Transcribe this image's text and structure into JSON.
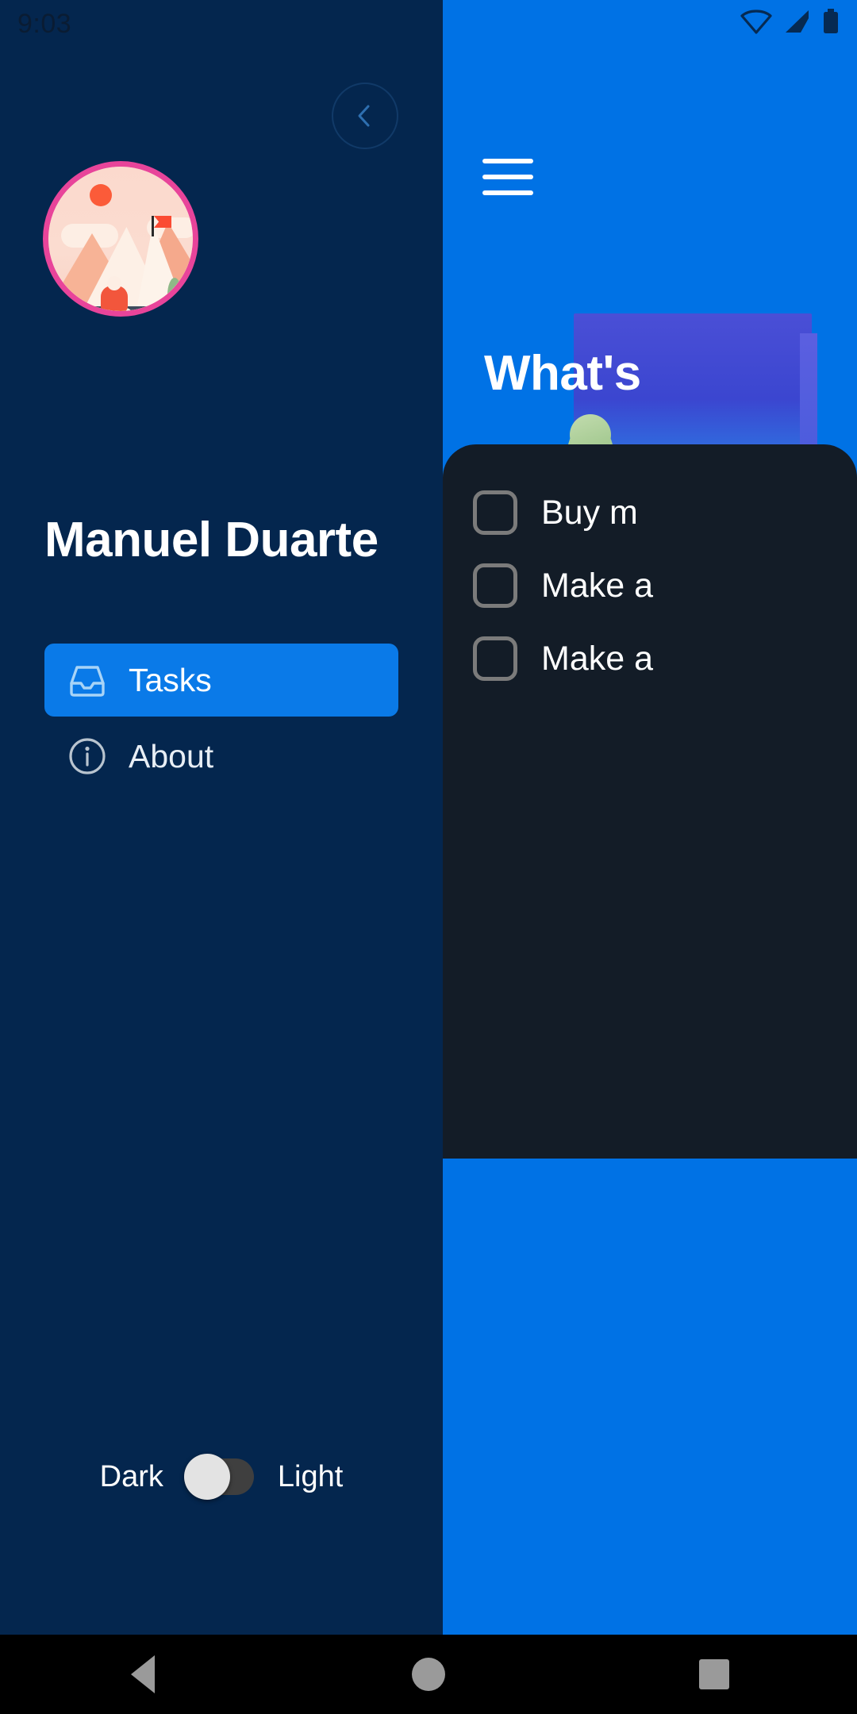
{
  "status_bar": {
    "time": "9:03",
    "icons": [
      "wifi-icon",
      "cellular-signal-icon",
      "battery-icon"
    ]
  },
  "drawer": {
    "back_button_icon": "chevron-left-icon",
    "avatar": {
      "icon": "avatar-mountain-illustration",
      "ring_color": "#e8449a"
    },
    "user_name": "Manuel Duarte",
    "nav_items": [
      {
        "label": "Tasks",
        "icon": "inbox-tray-icon",
        "selected": true
      },
      {
        "label": "About",
        "icon": "info-circle-icon",
        "selected": false
      }
    ],
    "theme_toggle": {
      "left_label": "Dark",
      "right_label": "Light",
      "state": "dark",
      "thumb_color": "#e3e3e3",
      "track_color": "#3f3f3f"
    },
    "background_color": "#04264e",
    "accent_color": "#0a7ae8"
  },
  "app": {
    "menu_icon": "hamburger-menu-icon",
    "hero_title": "What's",
    "header_color": "#0072E5",
    "card_color": "#131c27",
    "tasks": [
      {
        "label": "Buy m",
        "checked": false
      },
      {
        "label": "Make a",
        "checked": false
      },
      {
        "label": "Make a",
        "checked": false
      }
    ]
  },
  "navigation_bar": {
    "back_icon": "triangle-back-icon",
    "home_icon": "circle-home-icon",
    "recents_icon": "square-recents-icon"
  }
}
